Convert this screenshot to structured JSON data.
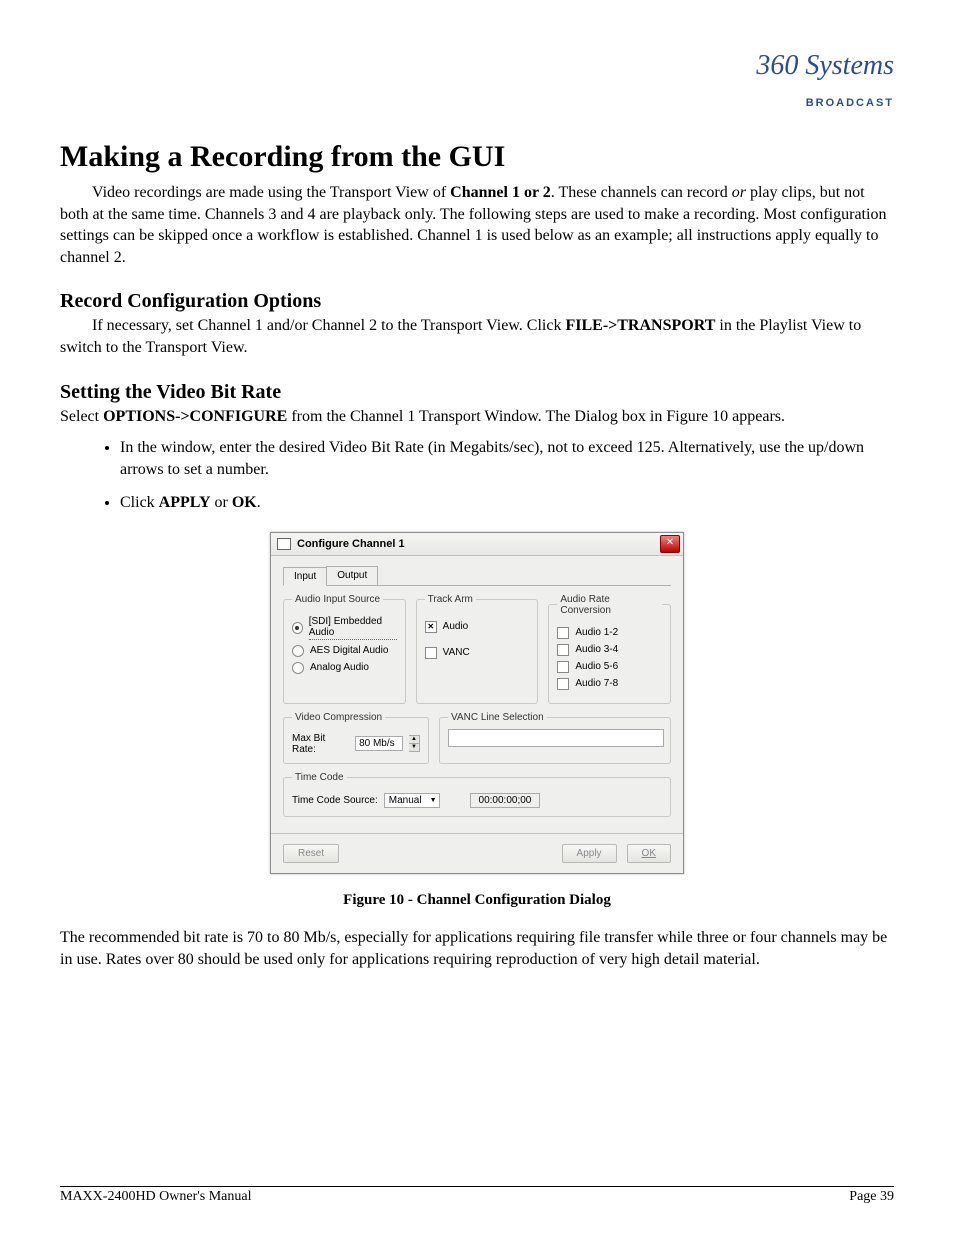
{
  "logo": {
    "top": "360 Systems",
    "sub": "BROADCAST"
  },
  "h1": "Making a Recording from the GUI",
  "intro_parts": {
    "a": "Video recordings are made using the Transport View of ",
    "b_bold": "Channel 1 or 2",
    "c": ". These channels can record ",
    "d_em": "or",
    "e": " play clips, but not both at the same time. Channels 3 and 4 are playback only. The following steps are used to make a recording. Most configuration settings can be skipped once a workflow is established. Channel 1 is used below as an example; all instructions apply equally to channel 2."
  },
  "h2a": "Record Configuration Options",
  "p2_parts": {
    "a": "If necessary, set Channel 1 and/or Channel 2 to the Transport View. Click ",
    "b_bold": "FILE->TRANSPORT",
    "c": " in the Playlist View to switch to the Transport View."
  },
  "h2b": "Setting the Video Bit Rate",
  "p3_parts": {
    "a": "Select ",
    "b_bold": "OPTIONS->CONFIGURE",
    "c": " from the Channel 1 Transport Window. The Dialog box in Figure 10 appears."
  },
  "bullets": {
    "b1": "In the window, enter the desired Video Bit Rate (in Megabits/sec), not to exceed 125. Alternatively, use the up/down arrows to set a number.",
    "b2_a": "Click ",
    "b2_b_bold": "APPLY",
    "b2_c": " or ",
    "b2_d_bold": "OK",
    "b2_e": "."
  },
  "dialog": {
    "title": "Configure Channel 1",
    "tabs": {
      "input": "Input",
      "output": "Output"
    },
    "groups": {
      "audio_input": {
        "legend": "Audio Input Source",
        "opt1": "[SDI] Embedded Audio",
        "opt2": "AES Digital Audio",
        "opt3": "Analog Audio"
      },
      "track_arm": {
        "legend": "Track Arm",
        "opt1": "Audio",
        "opt2": "VANC"
      },
      "rate_conv": {
        "legend": "Audio Rate Conversion",
        "opt1": "Audio 1-2",
        "opt2": "Audio 3-4",
        "opt3": "Audio 5-6",
        "opt4": "Audio 7-8"
      },
      "video_comp": {
        "legend": "Video Compression",
        "label": "Max Bit Rate:",
        "value": "80 Mb/s"
      },
      "vanc": {
        "legend": "VANC Line Selection"
      },
      "timecode": {
        "legend": "Time Code",
        "label": "Time Code Source:",
        "combo": "Manual",
        "value": "00:00:00;00"
      }
    },
    "buttons": {
      "reset": "Reset",
      "apply": "Apply",
      "ok": "OK"
    }
  },
  "figure_caption": "Figure 10 - Channel Configuration Dialog",
  "p4": "The recommended bit rate is 70 to 80 Mb/s, especially for applications requiring file transfer while three or four channels may be in use. Rates over 80 should be used only for applications requiring reproduction of very high detail material.",
  "footer": {
    "left": "MAXX-2400HD Owner's Manual",
    "right": "Page 39"
  }
}
